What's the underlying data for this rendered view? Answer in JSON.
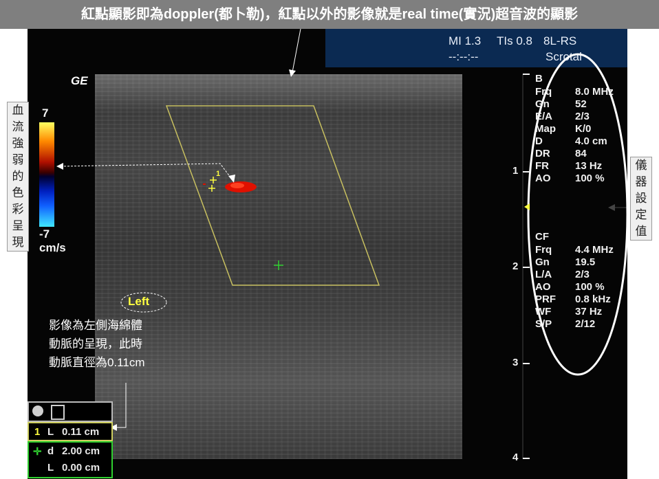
{
  "banner": {
    "text": "紅點顯影即為doppler(都卜勒)，紅點以外的影像就是real time(實況)超音波的顯影"
  },
  "header": {
    "mi": "MI 1.3",
    "tis": "TIs 0.8",
    "probe": "8L-RS",
    "time": "--:--:--",
    "preset": "Scrotal"
  },
  "logo": "GE",
  "b_mode": {
    "title": "B",
    "params": [
      {
        "k": "Frq",
        "v": "8.0 MHz"
      },
      {
        "k": "Gn",
        "v": "52"
      },
      {
        "k": "E/A",
        "v": "2/3"
      },
      {
        "k": "Map",
        "v": "K/0"
      },
      {
        "k": "D",
        "v": "4.0 cm"
      },
      {
        "k": "DR",
        "v": "84"
      },
      {
        "k": "FR",
        "v": "13 Hz"
      },
      {
        "k": "AO",
        "v": "100 %"
      }
    ]
  },
  "cf_mode": {
    "title": "CF",
    "params": [
      {
        "k": "Frq",
        "v": "4.4 MHz"
      },
      {
        "k": "Gn",
        "v": "19.5"
      },
      {
        "k": "L/A",
        "v": "2/3"
      },
      {
        "k": "AO",
        "v": "100 %"
      },
      {
        "k": "PRF",
        "v": "0.8 kHz"
      },
      {
        "k": "WF",
        "v": "37 Hz"
      },
      {
        "k": "S/P",
        "v": "2/12"
      }
    ]
  },
  "depth_labels": [
    "1",
    "2",
    "3",
    "4"
  ],
  "color_scale": {
    "max": "7",
    "min": "-7",
    "unit": "cm/s"
  },
  "left_label": {
    "chars": [
      "血",
      "流",
      "強",
      "弱",
      "的",
      "色",
      "彩",
      "呈",
      "現"
    ]
  },
  "right_label": {
    "chars": [
      "儀",
      "器",
      "設",
      "定",
      "值"
    ]
  },
  "side_label": "Left",
  "annotation": {
    "lines": [
      "影像為左側海綿體",
      "動脈的呈現，此時",
      "動脈直徑為0.11cm"
    ]
  },
  "caliper_marks": {
    "one": "1"
  },
  "measurements": {
    "m1": {
      "index": "1",
      "label": "L",
      "value": "0.11 cm"
    },
    "m2": {
      "label": "d",
      "value": "2.00 cm"
    },
    "m3": {
      "label": "L",
      "value": "0.00 cm"
    }
  },
  "colors": {
    "accent_yellow": "#ffff40",
    "doppler_red": "#e01000",
    "caliper_green": "#30d030",
    "roi_box": "#c8c060"
  }
}
